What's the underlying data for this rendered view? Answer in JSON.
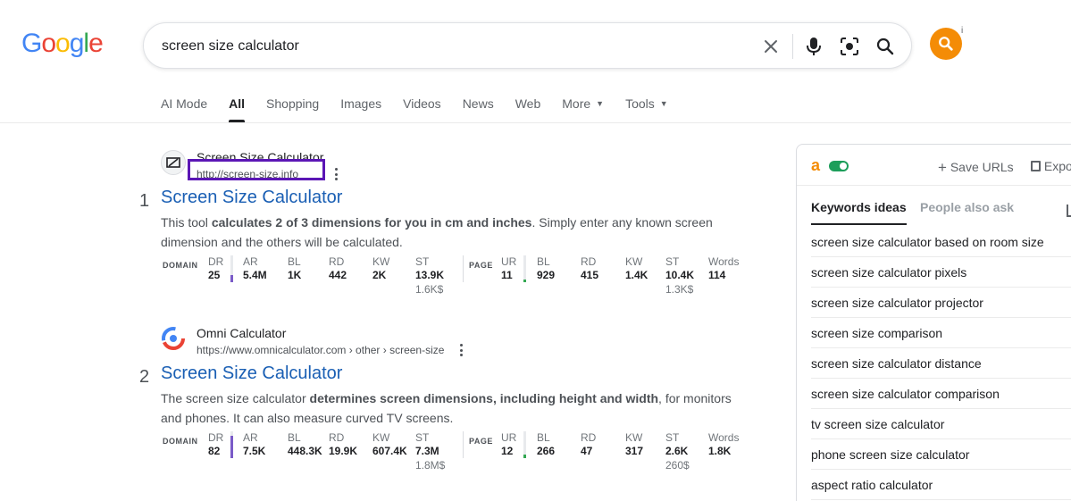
{
  "header": {
    "logo_letters": [
      {
        "ch": "G",
        "color": "#4285F4"
      },
      {
        "ch": "o",
        "color": "#EA4335"
      },
      {
        "ch": "o",
        "color": "#FBBC05"
      },
      {
        "ch": "g",
        "color": "#4285F4"
      },
      {
        "ch": "l",
        "color": "#34A853"
      },
      {
        "ch": "e",
        "color": "#EA4335"
      }
    ],
    "search_value": "screen size calculator",
    "avatar_sup": "i"
  },
  "tabs": [
    {
      "label": "AI Mode",
      "active": false
    },
    {
      "label": "All",
      "active": true
    },
    {
      "label": "Shopping",
      "active": false
    },
    {
      "label": "Images",
      "active": false
    },
    {
      "label": "Videos",
      "active": false
    },
    {
      "label": "News",
      "active": false
    },
    {
      "label": "Web",
      "active": false
    },
    {
      "label": "More",
      "active": false,
      "caret": true
    },
    {
      "label": "Tools",
      "active": false,
      "caret": true
    }
  ],
  "results": [
    {
      "rank": "1",
      "site_name": "Screen Size Calculator",
      "url": "http://screen-size.info",
      "highlighted_url": true,
      "title": "Screen Size Calculator",
      "snippet_parts": [
        {
          "t": "This tool ",
          "b": false
        },
        {
          "t": "calculates 2 of 3 dimensions for you in cm and inches",
          "b": true
        },
        {
          "t": ". Simply enter any known screen dimension and the others will be calculated.",
          "b": false
        }
      ],
      "domain_label": "DOMAIN",
      "page_label": "PAGE",
      "domain_metrics": [
        {
          "key": "DR",
          "value": "25",
          "sub": ""
        },
        {
          "key": "AR",
          "value": "5.4M",
          "sub": ""
        },
        {
          "key": "BL",
          "value": "1K",
          "sub": ""
        },
        {
          "key": "RD",
          "value": "442",
          "sub": ""
        },
        {
          "key": "KW",
          "value": "2K",
          "sub": ""
        },
        {
          "key": "ST",
          "value": "13.9K",
          "sub": "1.6K$"
        }
      ],
      "page_metrics": [
        {
          "key": "UR",
          "value": "11",
          "sub": ""
        },
        {
          "key": "BL",
          "value": "929",
          "sub": ""
        },
        {
          "key": "RD",
          "value": "415",
          "sub": ""
        },
        {
          "key": "KW",
          "value": "1.4K",
          "sub": ""
        },
        {
          "key": "ST",
          "value": "10.4K",
          "sub": "1.3K$"
        },
        {
          "key": "Words",
          "value": "114",
          "sub": ""
        }
      ],
      "dr_level": 25,
      "ur_level": 11
    },
    {
      "rank": "2",
      "site_name": "Omni Calculator",
      "url": "https://www.omnicalculator.com › other › screen-size",
      "highlighted_url": false,
      "title": "Screen Size Calculator",
      "snippet_parts": [
        {
          "t": "The screen size calculator ",
          "b": false
        },
        {
          "t": "determines screen dimensions, including height and width",
          "b": true
        },
        {
          "t": ", for monitors and phones. It can also measure curved TV screens.",
          "b": false
        }
      ],
      "domain_label": "DOMAIN",
      "page_label": "PAGE",
      "domain_metrics": [
        {
          "key": "DR",
          "value": "82",
          "sub": ""
        },
        {
          "key": "AR",
          "value": "7.5K",
          "sub": ""
        },
        {
          "key": "BL",
          "value": "448.3K",
          "sub": ""
        },
        {
          "key": "RD",
          "value": "19.9K",
          "sub": ""
        },
        {
          "key": "KW",
          "value": "607.4K",
          "sub": ""
        },
        {
          "key": "ST",
          "value": "7.3M",
          "sub": "1.8M$"
        }
      ],
      "page_metrics": [
        {
          "key": "UR",
          "value": "12",
          "sub": ""
        },
        {
          "key": "BL",
          "value": "266",
          "sub": ""
        },
        {
          "key": "RD",
          "value": "47",
          "sub": ""
        },
        {
          "key": "KW",
          "value": "317",
          "sub": ""
        },
        {
          "key": "ST",
          "value": "2.6K",
          "sub": "260$"
        },
        {
          "key": "Words",
          "value": "1.8K",
          "sub": ""
        }
      ],
      "dr_level": 82,
      "ur_level": 12
    }
  ],
  "panel": {
    "logo": "a",
    "save_urls": "Save URLs",
    "export": "Expo",
    "tab_keywords": "Keywords ideas",
    "tab_people": "People also ask",
    "keywords": [
      "screen size calculator based on room size",
      "screen size calculator pixels",
      "screen size calculator projector",
      "screen size comparison",
      "screen size calculator distance",
      "screen size calculator comparison",
      "tv screen size calculator",
      "phone screen size calculator",
      "aspect ratio calculator"
    ]
  },
  "colors": {
    "dr_bar": "#7a5bc8",
    "ur_bar": "#34a853",
    "highlight": "#5b16b5",
    "link": "#1a5fb4"
  }
}
